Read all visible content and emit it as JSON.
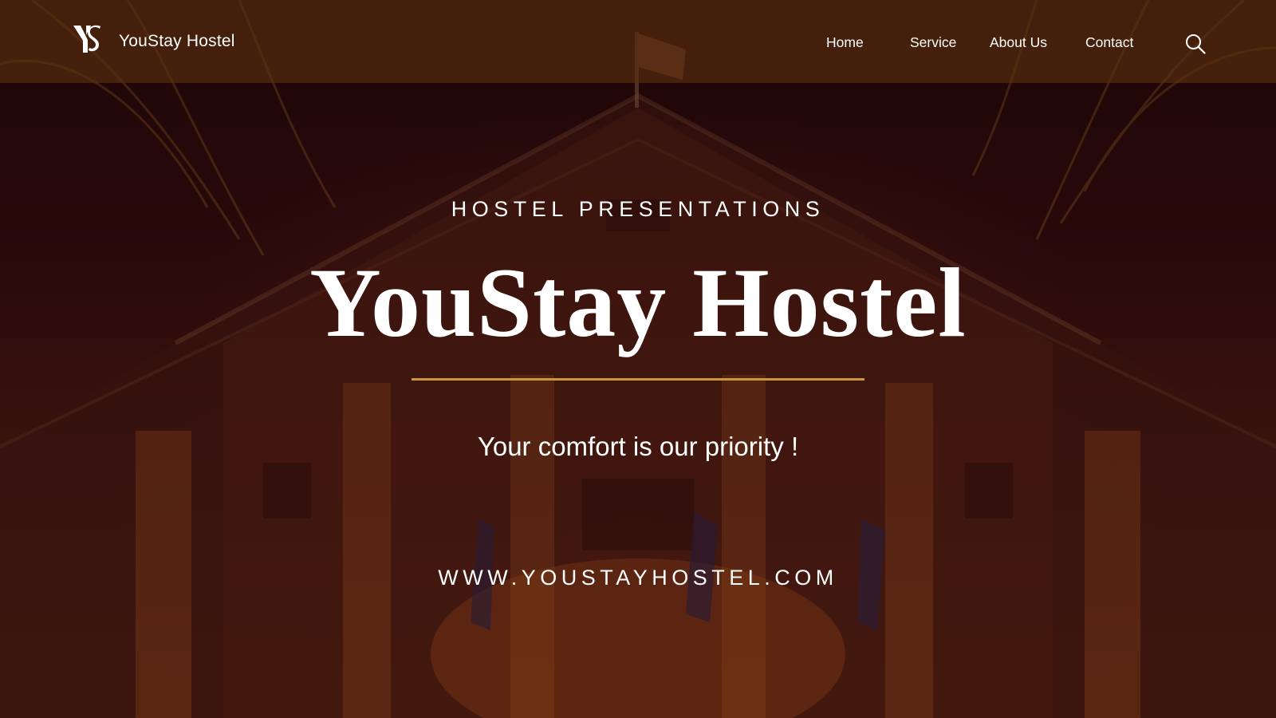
{
  "header": {
    "brand_name": "YouStay Hostel",
    "logo_icon": "ys-monogram-logo",
    "nav": {
      "home": "Home",
      "service": "Service",
      "about": "About Us",
      "contact": "Contact"
    },
    "search_icon": "search-icon"
  },
  "hero": {
    "eyebrow": "HOSTEL PRESENTATIONS",
    "title": "YouStay Hostel",
    "tagline": "Your comfort is our priority !",
    "website": "WWW.YOUSTAYHOSTEL.COM"
  },
  "colors": {
    "accent_rule": "#c9953f",
    "header_bg": "#5c300e",
    "text": "#ffffff"
  }
}
